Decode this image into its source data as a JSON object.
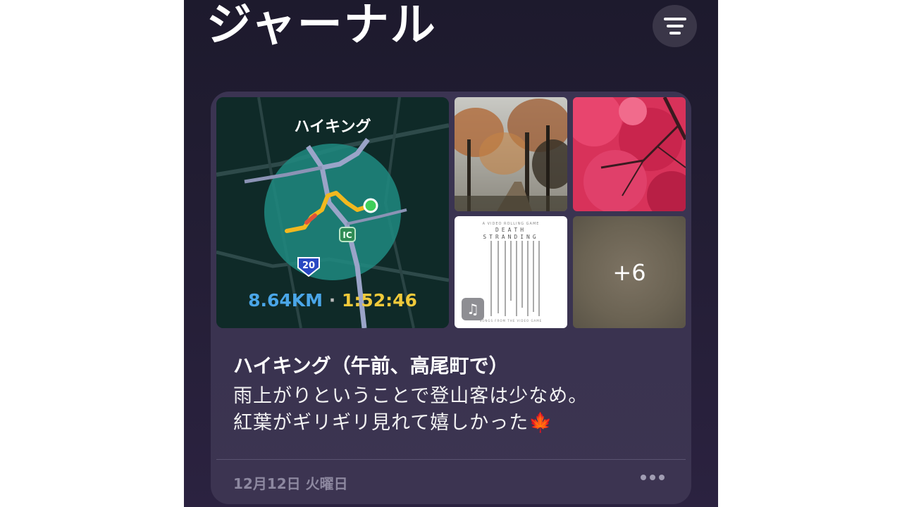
{
  "app": {
    "title": "ジャーナル"
  },
  "toolbar": {
    "filter_icon": "filter-lines-icon"
  },
  "entry": {
    "workout": {
      "label": "ハイキング",
      "distance": "8.64KM",
      "separator": "·",
      "duration": "1:52:46",
      "map_labels": {
        "interchange": "IC",
        "route": "20"
      }
    },
    "album": {
      "top": "A VIDEO ROLLING GAME",
      "title_line1": "DEATH",
      "title_line2": "STRANDING",
      "bottom": "SONGS FROM THE VIDEO GAME",
      "badge_icon": "music-note-icon"
    },
    "extra_count": "+6",
    "title": "ハイキング（午前、高尾町で）",
    "body_line1": "雨上がりということで登山客は少なめ。",
    "body_line2": "紅葉がギリギリ見れて嬉しかった🍁",
    "date": "12月12日 火曜日"
  },
  "colors": {
    "distance": "#4aa6e8",
    "duration": "#f0c93a",
    "route_path": "#f2b81f",
    "start_marker": "#3fcf5a"
  }
}
